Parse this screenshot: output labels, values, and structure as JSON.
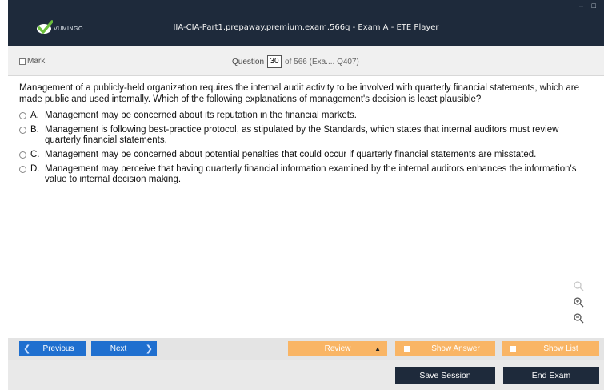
{
  "window": {
    "brand": "VUMINGO",
    "title": "IIA-CIA-Part1.prepaway.premium.exam.566q - Exam A - ETE Player",
    "controls": "– □"
  },
  "question_bar": {
    "mark_label": "Mark",
    "question_label": "Question",
    "question_number": "30",
    "of_text": "of 566 (Exa.... Q407)"
  },
  "question": {
    "text": "Management of a publicly-held organization requires the internal audit activity to be involved with quarterly financial statements, which are made public and used internally. Which of the following explanations of management's decision is least plausible?",
    "options": [
      {
        "letter": "A.",
        "text": "Management may be concerned about its reputation in the financial markets."
      },
      {
        "letter": "B.",
        "text": "Management is following best-practice protocol, as stipulated by the Standards, which states that internal auditors must review quarterly financial statements."
      },
      {
        "letter": "C.",
        "text": "Management may be concerned about potential penalties that could occur if quarterly financial statements are misstated."
      },
      {
        "letter": "D.",
        "text": "Management may perceive that having quarterly financial information examined by the internal auditors enhances the information's value to internal decision making."
      }
    ]
  },
  "toolbar": {
    "previous_label": "Previous",
    "next_label": "Next",
    "review_label": "Review",
    "show_answer_label": "Show Answer",
    "show_list_label": "Show List"
  },
  "footer": {
    "save_session_label": "Save Session",
    "end_exam_label": "End Exam"
  },
  "colors": {
    "title_bar": "#1e2a3b",
    "nav_button": "#1f6fcf",
    "orange_button": "#f9b565",
    "dark_button": "#1e2a3b"
  }
}
